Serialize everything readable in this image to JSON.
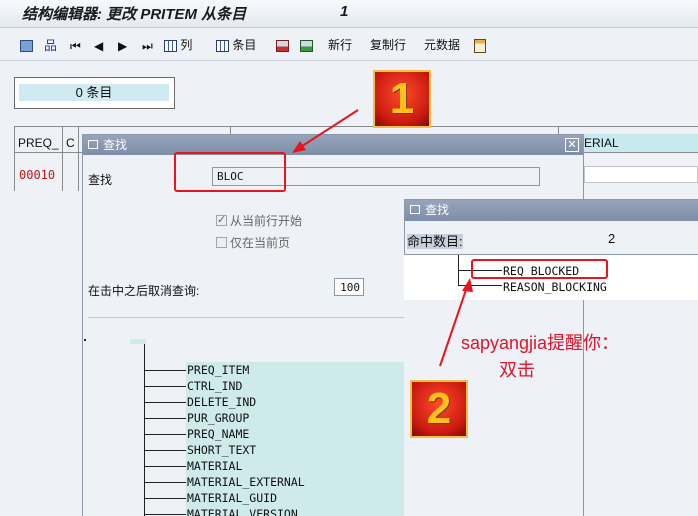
{
  "window": {
    "title": "结构编辑器: 更改 PRITEM 从条目",
    "title_count": "1"
  },
  "toolbar": {
    "columns_label": "列",
    "entry_label": "条目",
    "new_row_label": "新行",
    "copy_row_label": "复制行",
    "metadata_label": "元数据"
  },
  "entry_count": "0 条目",
  "table": {
    "col1": "PREQ_",
    "col2": "C",
    "col_material": "ERIAL",
    "row_value": "00010"
  },
  "find_dialog": {
    "title": "查找",
    "search_label": "查找",
    "search_value": "BLOC",
    "opt_from_current": "从当前行开始",
    "opt_current_page": "仅在当前页",
    "cancel_after_label": "在击中之后取消查询:",
    "cancel_after_value": "100"
  },
  "tree_fields": [
    "PREQ_ITEM",
    "CTRL_IND",
    "DELETE_IND",
    "PUR_GROUP",
    "PREQ_NAME",
    "SHORT_TEXT",
    "MATERIAL",
    "MATERIAL_EXTERNAL",
    "MATERIAL_GUID",
    "MATERIAL_VERSION"
  ],
  "result_dialog": {
    "title": "查找",
    "hits_label": "命中数目:",
    "hits_value": "2",
    "results": [
      "REQ_BLOCKED",
      "REASON_BLOCKING"
    ]
  },
  "annotations": {
    "badge1": "1",
    "badge2": "2",
    "note_line1": "sapyangjia提醒你：",
    "note_line2": "双击"
  },
  "colors": {
    "accent_red": "#e8141e",
    "cyan_highlight": "#cfeaea",
    "dialog_header": "#8898b2"
  }
}
